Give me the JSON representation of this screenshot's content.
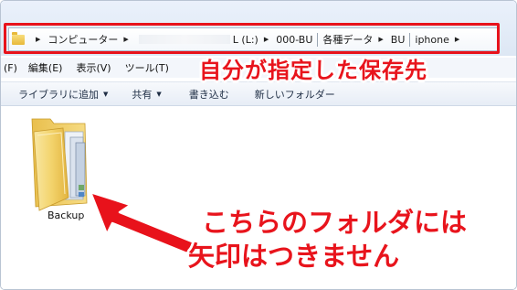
{
  "address_bar": {
    "crumbs": [
      "コンピューター",
      "L (L:)",
      "000-BU",
      "各種データ",
      "BU",
      "iphone"
    ]
  },
  "callouts": {
    "save_location": "自分が指定した保存先",
    "no_arrow_line1": "こちらのフォルダには",
    "no_arrow_line2": "矢印はつきません"
  },
  "menu": {
    "items": [
      "(F)",
      "編集(E)",
      "表示(V)",
      "ツール(T)"
    ]
  },
  "toolbar": {
    "library_label": "ライブラリに追加",
    "share_label": "共有",
    "burn_label": "書き込む",
    "new_folder_label": "新しいフォルダー"
  },
  "content": {
    "folder_name": "Backup"
  },
  "colors": {
    "callout_red": "#e8121b",
    "folder_yellow": "#f3d06a"
  }
}
